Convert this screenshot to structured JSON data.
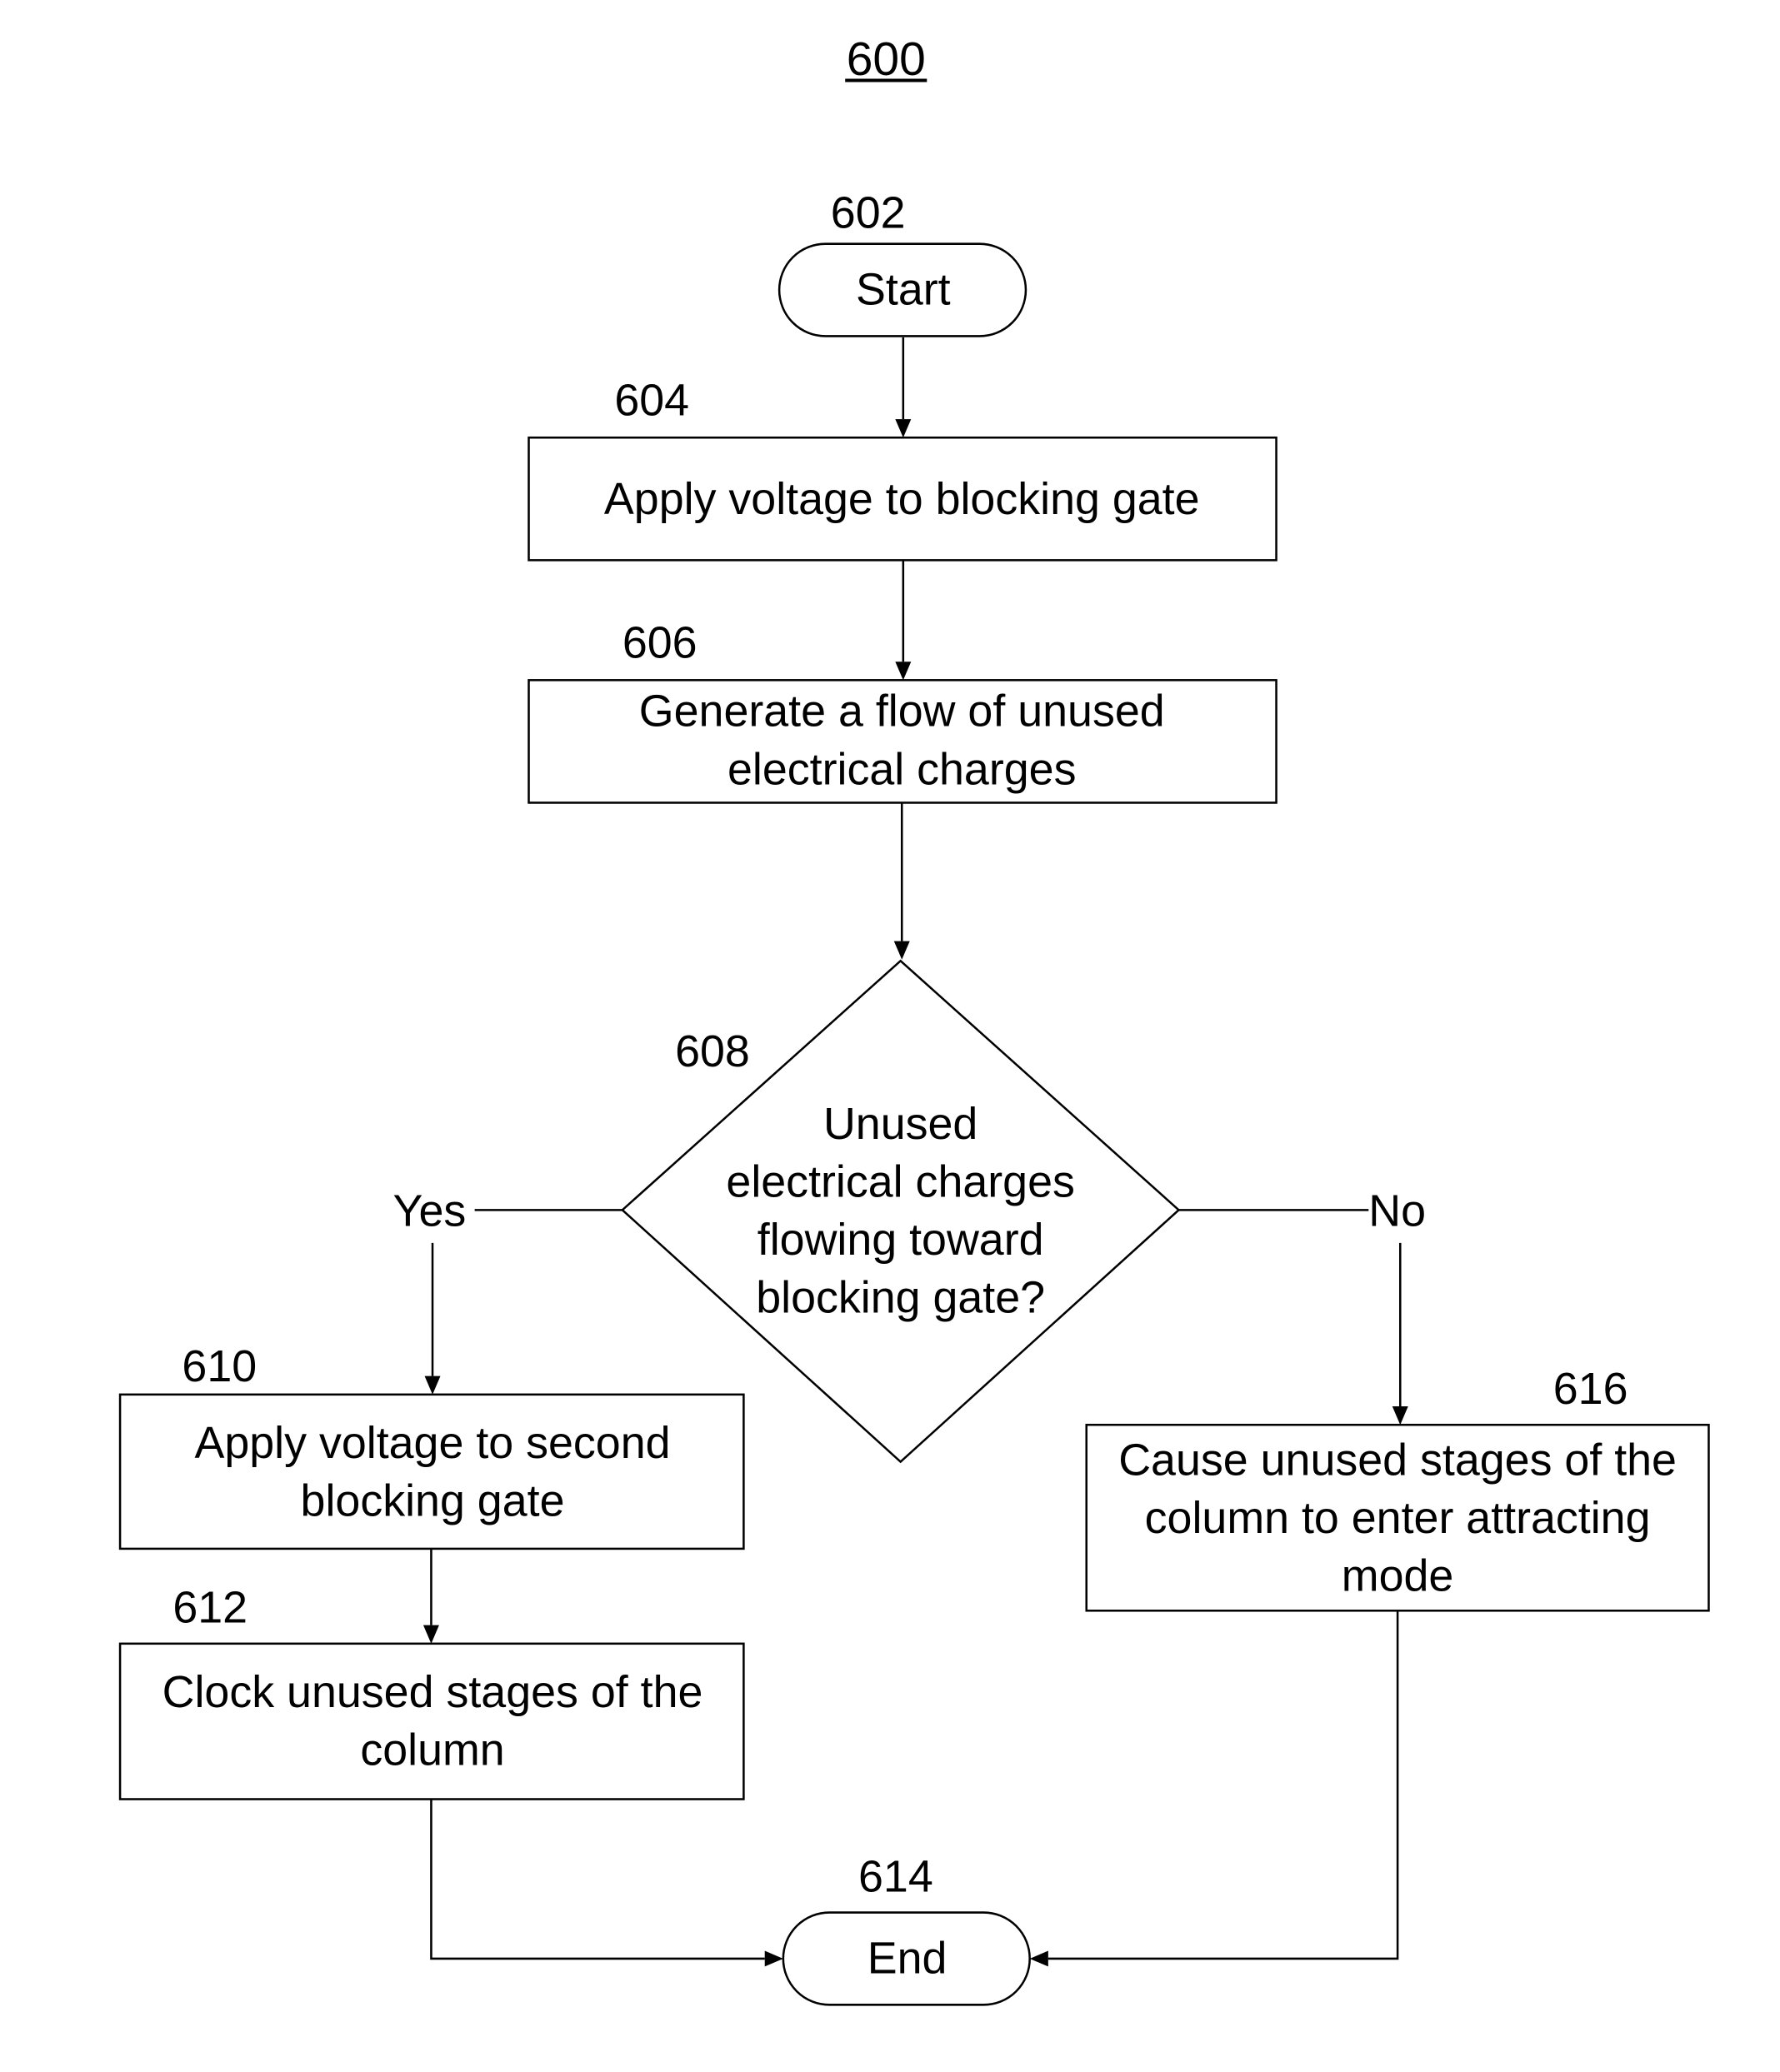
{
  "figure": {
    "number": "600"
  },
  "nodes": {
    "start": {
      "ref": "602",
      "type": "terminal",
      "lines": [
        "Start"
      ]
    },
    "step604": {
      "ref": "604",
      "type": "process",
      "lines": [
        "Apply voltage to blocking gate"
      ]
    },
    "step606": {
      "ref": "606",
      "type": "process",
      "lines": [
        "Generate a flow of unused",
        "electrical charges"
      ]
    },
    "decision608": {
      "ref": "608",
      "type": "decision",
      "lines": [
        "Unused",
        "electrical charges",
        "flowing toward",
        "blocking gate?"
      ]
    },
    "step610": {
      "ref": "610",
      "type": "process",
      "lines": [
        "Apply voltage to second",
        "blocking gate"
      ]
    },
    "step612": {
      "ref": "612",
      "type": "process",
      "lines": [
        "Clock unused stages of the",
        "column"
      ]
    },
    "step616": {
      "ref": "616",
      "type": "process",
      "lines": [
        "Cause unused stages of the",
        "column to enter attracting",
        "mode"
      ]
    },
    "end": {
      "ref": "614",
      "type": "terminal",
      "lines": [
        "End"
      ]
    }
  },
  "edges": {
    "yes_label": "Yes",
    "no_label": "No"
  }
}
